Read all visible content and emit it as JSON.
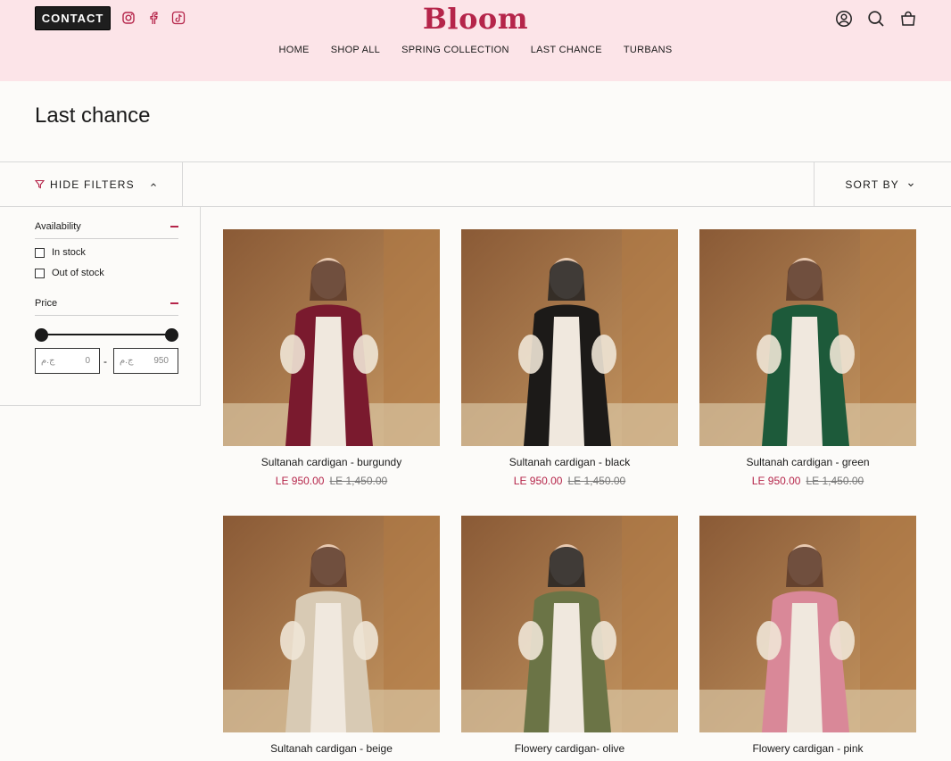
{
  "header": {
    "contact_label": "CONTACT",
    "brand": "Bloom",
    "nav": [
      "HOME",
      "SHOP ALL",
      "SPRING COLLECTION",
      "LAST CHANCE",
      "TURBANS"
    ]
  },
  "page": {
    "title": "Last chance"
  },
  "toolbar": {
    "hide_filters": "HIDE FILTERS",
    "sort_by": "SORT BY"
  },
  "filters": {
    "availability": {
      "label": "Availability",
      "options": [
        "In stock",
        "Out of stock"
      ]
    },
    "price": {
      "label": "Price",
      "currency": "ج.م",
      "min": "0",
      "max": "950",
      "separator": "-"
    }
  },
  "products": [
    {
      "name": "Sultanah cardigan - burgundy",
      "price": "LE 950.00",
      "compare_price": "LE 1,450.00",
      "color": "#7a1a2e"
    },
    {
      "name": "Sultanah cardigan - black",
      "price": "LE 950.00",
      "compare_price": "LE 1,450.00",
      "color": "#1c1a18"
    },
    {
      "name": "Sultanah cardigan - green",
      "price": "LE 950.00",
      "compare_price": "LE 1,450.00",
      "color": "#1d5a3a"
    },
    {
      "name": "Sultanah cardigan - beige",
      "color": "#d8cab4"
    },
    {
      "name": "Flowery cardigan- olive",
      "color": "#6b7446"
    },
    {
      "name": "Flowery cardigan - pink",
      "color": "#d98898"
    }
  ],
  "colors": {
    "brand": "#b5254a",
    "header_bg": "#fce4e8"
  },
  "icons": [
    "instagram-icon",
    "facebook-icon",
    "tiktok-icon",
    "account-icon",
    "search-icon",
    "bag-icon",
    "filter-icon",
    "chevron-up-icon",
    "chevron-down-icon"
  ]
}
